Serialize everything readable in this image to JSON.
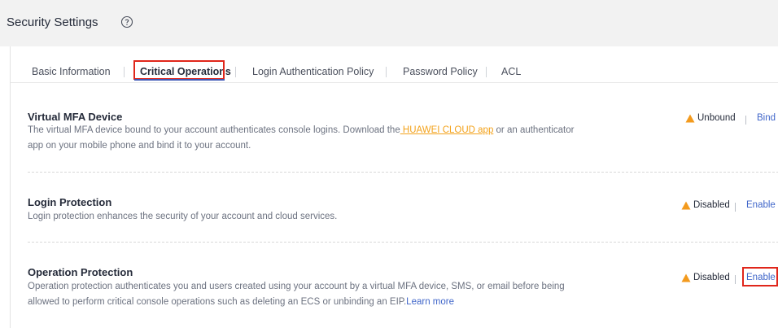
{
  "header": {
    "title": "Security Settings",
    "help_icon": "help-circle-icon"
  },
  "tabs": [
    {
      "label": "Basic Information",
      "active": false
    },
    {
      "label": "Critical Operations",
      "active": true
    },
    {
      "label": "Login Authentication Policy",
      "active": false
    },
    {
      "label": "Password Policy",
      "active": false
    },
    {
      "label": "ACL",
      "active": false
    }
  ],
  "sections": {
    "mfa": {
      "title": "Virtual MFA Device",
      "desc_part1": "The virtual MFA device bound to your account authenticates console logins. Download the",
      "desc_link": " HUAWEI CLOUD app",
      "desc_part2": " or an authenticator app on your mobile phone and bind it to your account.",
      "status": "Unbound",
      "action": "Bind"
    },
    "login_protection": {
      "title": "Login Protection",
      "desc": "Login protection enhances the security of your account and cloud services.",
      "status": "Disabled",
      "action": "Enable"
    },
    "operation_protection": {
      "title": "Operation Protection",
      "desc_part1": "Operation protection authenticates you and users created using your account by a virtual MFA device, SMS, or email before being allowed to perform critical console operations such as deleting an ECS or unbinding an EIP.",
      "desc_link": "Learn more",
      "status": "Disabled",
      "action": "Enable"
    }
  },
  "colors": {
    "warning": "#f39a1d",
    "link": "#3f65c9",
    "highlight": "#e0261b",
    "tab_underline": "#3f58b6"
  },
  "icons": {
    "status_icon": "warning-triangle-icon"
  }
}
